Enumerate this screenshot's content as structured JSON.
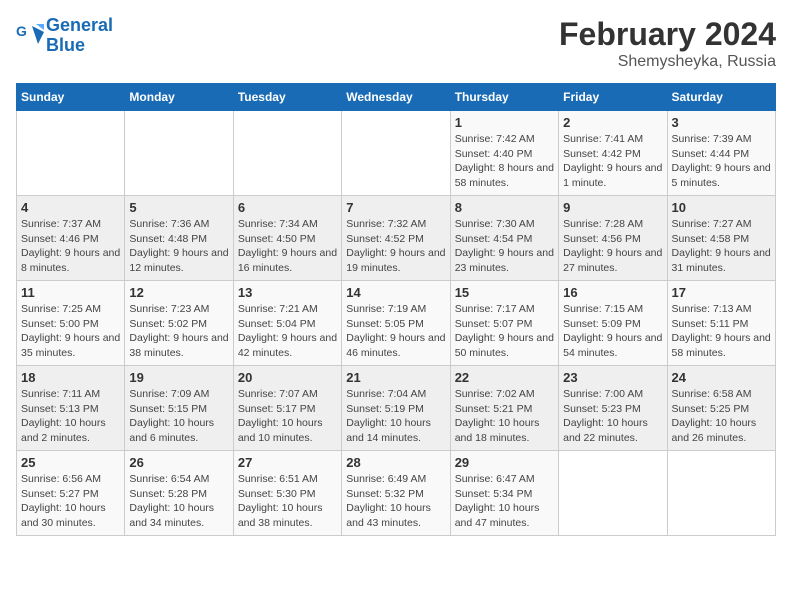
{
  "header": {
    "logo_line1": "General",
    "logo_line2": "Blue",
    "title": "February 2024",
    "subtitle": "Shemysheyka, Russia"
  },
  "days_of_week": [
    "Sunday",
    "Monday",
    "Tuesday",
    "Wednesday",
    "Thursday",
    "Friday",
    "Saturday"
  ],
  "weeks": [
    [
      {
        "day": "",
        "info": ""
      },
      {
        "day": "",
        "info": ""
      },
      {
        "day": "",
        "info": ""
      },
      {
        "day": "",
        "info": ""
      },
      {
        "day": "1",
        "info": "Sunrise: 7:42 AM\nSunset: 4:40 PM\nDaylight: 8 hours and 58 minutes."
      },
      {
        "day": "2",
        "info": "Sunrise: 7:41 AM\nSunset: 4:42 PM\nDaylight: 9 hours and 1 minute."
      },
      {
        "day": "3",
        "info": "Sunrise: 7:39 AM\nSunset: 4:44 PM\nDaylight: 9 hours and 5 minutes."
      }
    ],
    [
      {
        "day": "4",
        "info": "Sunrise: 7:37 AM\nSunset: 4:46 PM\nDaylight: 9 hours and 8 minutes."
      },
      {
        "day": "5",
        "info": "Sunrise: 7:36 AM\nSunset: 4:48 PM\nDaylight: 9 hours and 12 minutes."
      },
      {
        "day": "6",
        "info": "Sunrise: 7:34 AM\nSunset: 4:50 PM\nDaylight: 9 hours and 16 minutes."
      },
      {
        "day": "7",
        "info": "Sunrise: 7:32 AM\nSunset: 4:52 PM\nDaylight: 9 hours and 19 minutes."
      },
      {
        "day": "8",
        "info": "Sunrise: 7:30 AM\nSunset: 4:54 PM\nDaylight: 9 hours and 23 minutes."
      },
      {
        "day": "9",
        "info": "Sunrise: 7:28 AM\nSunset: 4:56 PM\nDaylight: 9 hours and 27 minutes."
      },
      {
        "day": "10",
        "info": "Sunrise: 7:27 AM\nSunset: 4:58 PM\nDaylight: 9 hours and 31 minutes."
      }
    ],
    [
      {
        "day": "11",
        "info": "Sunrise: 7:25 AM\nSunset: 5:00 PM\nDaylight: 9 hours and 35 minutes."
      },
      {
        "day": "12",
        "info": "Sunrise: 7:23 AM\nSunset: 5:02 PM\nDaylight: 9 hours and 38 minutes."
      },
      {
        "day": "13",
        "info": "Sunrise: 7:21 AM\nSunset: 5:04 PM\nDaylight: 9 hours and 42 minutes."
      },
      {
        "day": "14",
        "info": "Sunrise: 7:19 AM\nSunset: 5:05 PM\nDaylight: 9 hours and 46 minutes."
      },
      {
        "day": "15",
        "info": "Sunrise: 7:17 AM\nSunset: 5:07 PM\nDaylight: 9 hours and 50 minutes."
      },
      {
        "day": "16",
        "info": "Sunrise: 7:15 AM\nSunset: 5:09 PM\nDaylight: 9 hours and 54 minutes."
      },
      {
        "day": "17",
        "info": "Sunrise: 7:13 AM\nSunset: 5:11 PM\nDaylight: 9 hours and 58 minutes."
      }
    ],
    [
      {
        "day": "18",
        "info": "Sunrise: 7:11 AM\nSunset: 5:13 PM\nDaylight: 10 hours and 2 minutes."
      },
      {
        "day": "19",
        "info": "Sunrise: 7:09 AM\nSunset: 5:15 PM\nDaylight: 10 hours and 6 minutes."
      },
      {
        "day": "20",
        "info": "Sunrise: 7:07 AM\nSunset: 5:17 PM\nDaylight: 10 hours and 10 minutes."
      },
      {
        "day": "21",
        "info": "Sunrise: 7:04 AM\nSunset: 5:19 PM\nDaylight: 10 hours and 14 minutes."
      },
      {
        "day": "22",
        "info": "Sunrise: 7:02 AM\nSunset: 5:21 PM\nDaylight: 10 hours and 18 minutes."
      },
      {
        "day": "23",
        "info": "Sunrise: 7:00 AM\nSunset: 5:23 PM\nDaylight: 10 hours and 22 minutes."
      },
      {
        "day": "24",
        "info": "Sunrise: 6:58 AM\nSunset: 5:25 PM\nDaylight: 10 hours and 26 minutes."
      }
    ],
    [
      {
        "day": "25",
        "info": "Sunrise: 6:56 AM\nSunset: 5:27 PM\nDaylight: 10 hours and 30 minutes."
      },
      {
        "day": "26",
        "info": "Sunrise: 6:54 AM\nSunset: 5:28 PM\nDaylight: 10 hours and 34 minutes."
      },
      {
        "day": "27",
        "info": "Sunrise: 6:51 AM\nSunset: 5:30 PM\nDaylight: 10 hours and 38 minutes."
      },
      {
        "day": "28",
        "info": "Sunrise: 6:49 AM\nSunset: 5:32 PM\nDaylight: 10 hours and 43 minutes."
      },
      {
        "day": "29",
        "info": "Sunrise: 6:47 AM\nSunset: 5:34 PM\nDaylight: 10 hours and 47 minutes."
      },
      {
        "day": "",
        "info": ""
      },
      {
        "day": "",
        "info": ""
      }
    ]
  ]
}
